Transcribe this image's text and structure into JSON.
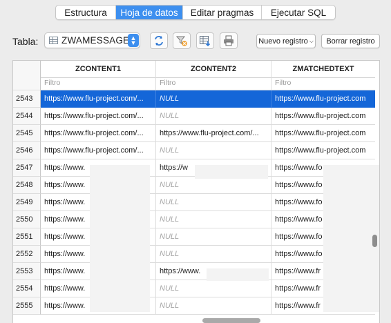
{
  "tabs": [
    {
      "label": "Estructura",
      "active": false
    },
    {
      "label": "Hoja de datos",
      "active": true
    },
    {
      "label": "Editar pragmas",
      "active": false
    },
    {
      "label": "Ejecutar SQL",
      "active": false
    }
  ],
  "toolbar": {
    "table_label": "Tabla:",
    "table_name": "ZWAMESSAGE",
    "icons": [
      "refresh-icon",
      "clear-filters-icon",
      "save-table-icon",
      "print-icon"
    ],
    "new_record_label": "Nuevo registro",
    "delete_record_label": "Borrar registro"
  },
  "grid": {
    "columns": [
      "ZCONTENT1",
      "ZCONTENT2",
      "ZMATCHEDTEXT"
    ],
    "filter_placeholder": "Filtro",
    "selected_row": "2543",
    "rows": [
      {
        "n": "2543",
        "c1": "https://www.flu-project.com/...",
        "c2": "NULL",
        "c3": "https://www.flu-project.com"
      },
      {
        "n": "2544",
        "c1": "https://www.flu-project.com/...",
        "c2": "NULL",
        "c3": "https://www.flu-project.com"
      },
      {
        "n": "2545",
        "c1": "https://www.flu-project.com/...",
        "c2": "https://www.flu-project.com/...",
        "c3": "https://www.flu-project.com"
      },
      {
        "n": "2546",
        "c1": "https://www.flu-project.com/...",
        "c2": "NULL",
        "c3": "https://www.flu-project.com"
      },
      {
        "n": "2547",
        "c1": "https://www.",
        "c2": "https://w",
        "c3": "https://www.fo"
      },
      {
        "n": "2548",
        "c1": "https://www.",
        "c2": "NULL",
        "c3": "https://www.fo"
      },
      {
        "n": "2549",
        "c1": "https://www.",
        "c2": "NULL",
        "c3": "https://www.fo"
      },
      {
        "n": "2550",
        "c1": "https://www.",
        "c2": "NULL",
        "c3": "https://www.fo"
      },
      {
        "n": "2551",
        "c1": "https://www.",
        "c2": "NULL",
        "c3": "https://www.fo"
      },
      {
        "n": "2552",
        "c1": "https://www.",
        "c2": "NULL",
        "c3": "https://www.fo"
      },
      {
        "n": "2553",
        "c1": "https://www.",
        "c2": "https://www.",
        "c3": "https://www.fr"
      },
      {
        "n": "2554",
        "c1": "https://www.",
        "c2": "NULL",
        "c3": "https://www.fr"
      },
      {
        "n": "2555",
        "c1": "https://www.",
        "c2": "NULL",
        "c3": "https://www.fr"
      }
    ]
  }
}
